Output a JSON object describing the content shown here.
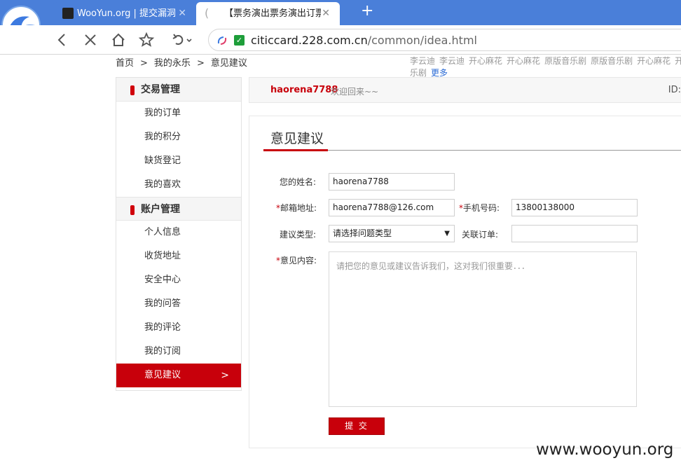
{
  "browser": {
    "tabs": [
      {
        "title": "WooYun.org | 提交漏洞"
      },
      {
        "title": "【票务演出票务演出订票票"
      }
    ],
    "address": {
      "host": "citiccard.228.com.cn",
      "path": "/common/idea.html"
    }
  },
  "breadcrumb": [
    "首页",
    "我的永乐",
    "意见建议"
  ],
  "top_tags": {
    "row1": [
      "李云迪",
      "李云迪",
      "开心麻花",
      "开心麻花",
      "原版音乐剧",
      "原版音乐剧",
      "开心麻花",
      "开心麻花"
    ],
    "row2_text": "乐剧",
    "more_label": "更多"
  },
  "sidebar": {
    "sections": [
      {
        "title": "交易管理",
        "items": [
          "我的订单",
          "我的积分",
          "缺货登记",
          "我的喜欢"
        ]
      },
      {
        "title": "账户管理",
        "items": [
          "个人信息",
          "收货地址",
          "安全中心",
          "我的问答",
          "我的评论",
          "我的订阅",
          "意见建议"
        ]
      }
    ],
    "active_item": "意见建议"
  },
  "welcome": {
    "username": "haorena7788",
    "text": "欢迎回来~~",
    "id_label": "ID:"
  },
  "form": {
    "title": "意见建议",
    "name_label": "您的姓名:",
    "name_value": "haorena7788",
    "email_label": "邮箱地址:",
    "email_value": "haorena7788@126.com",
    "phone_label": "手机号码:",
    "phone_value": "13800138000",
    "type_label": "建议类型:",
    "type_value": "请选择问题类型",
    "order_label": "关联订单:",
    "order_value": "",
    "content_label": "意见内容:",
    "content_placeholder": "请把您的意见或建议告诉我们，这对我们很重要．．．",
    "submit_label": "提 交",
    "required_mark": "*"
  },
  "watermark": "www.wooyun.org",
  "colors": {
    "accent": "#c8000b",
    "tabbar": "#4a7fd9",
    "link": "#2a6ad5"
  }
}
